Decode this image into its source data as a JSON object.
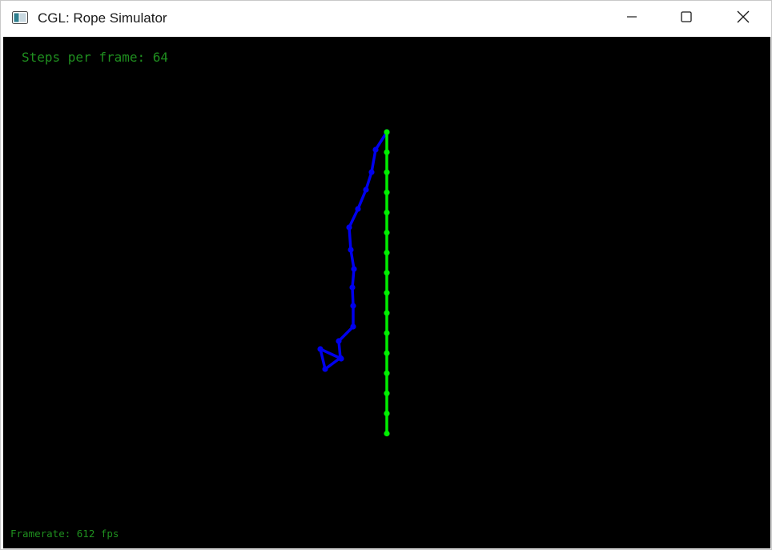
{
  "window": {
    "title": "CGL: Rope Simulator",
    "icon": "app-window-icon",
    "controls": {
      "minimize_icon": "minimize-icon",
      "maximize_icon": "maximize-icon",
      "close_icon": "close-icon"
    }
  },
  "overlay": {
    "steps_text": "Steps per frame: 64",
    "framerate_text": "Framerate: 612 fps"
  },
  "colors": {
    "background": "#000000",
    "hud_text": "#1f8f1f",
    "rope_blue": "#0000ee",
    "rope_green": "#00ee00"
  }
}
